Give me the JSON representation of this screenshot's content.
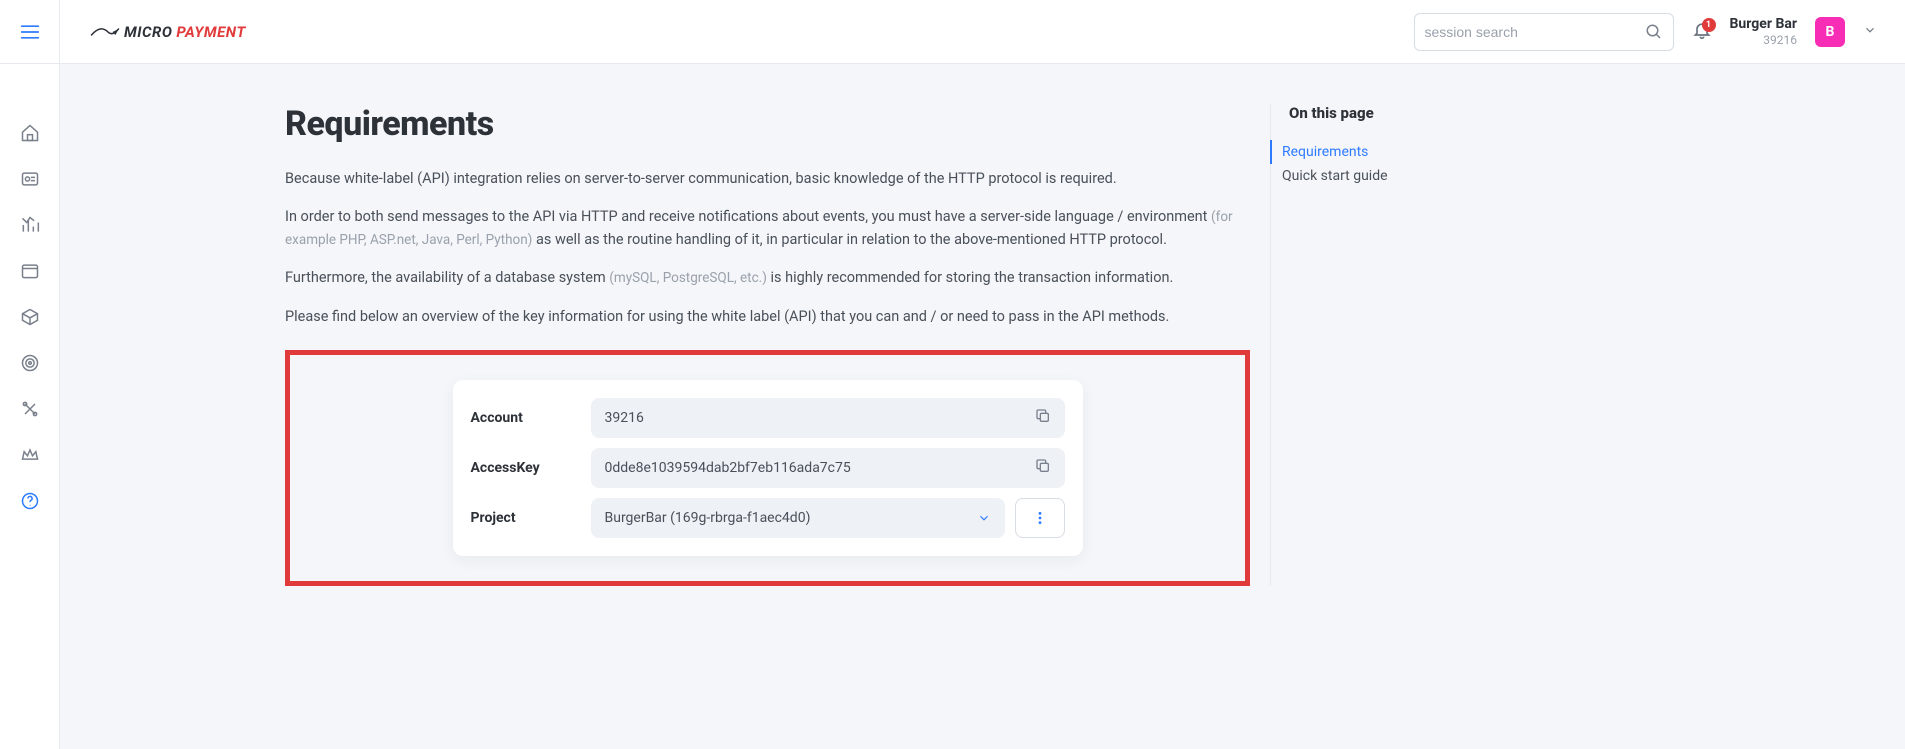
{
  "header": {
    "logo_micro": "MICRO",
    "logo_pay": "PAYMENT",
    "search_placeholder": "session search",
    "bell_count": "1",
    "org_name": "Burger Bar",
    "org_id": "39216",
    "avatar_letter": "B"
  },
  "page": {
    "title": "Requirements",
    "p1": "Because white-label (API) integration relies on server-to-server communication, basic knowledge of the HTTP protocol is required.",
    "p2a": "In order to both send messages to the API via HTTP and receive notifications about events, you must have a server-side language / environment ",
    "p2_muted": "(for example PHP, ASP.net, Java, Perl, Python)",
    "p2b": " as well as the routine handling of it, in particular in relation to the above-mentioned HTTP protocol.",
    "p3a": "Furthermore, the availability of a database system ",
    "p3_muted": "(mySQL, PostgreSQL, etc.)",
    "p3b": " is highly recommended for storing the transaction information.",
    "p4": "Please find below an overview of the key information for using the white label (API) that you can and / or need to pass in the API methods."
  },
  "fields": {
    "account_label": "Account",
    "account_value": "39216",
    "accesskey_label": "AccessKey",
    "accesskey_value": "0dde8e1039594dab2bf7eb116ada7c75",
    "project_label": "Project",
    "project_value": "BurgerBar (169g-rbrga-f1aec4d0)"
  },
  "toc": {
    "heading": "On this page",
    "link_requirements": "Requirements",
    "link_quickstart": "Quick start guide"
  }
}
